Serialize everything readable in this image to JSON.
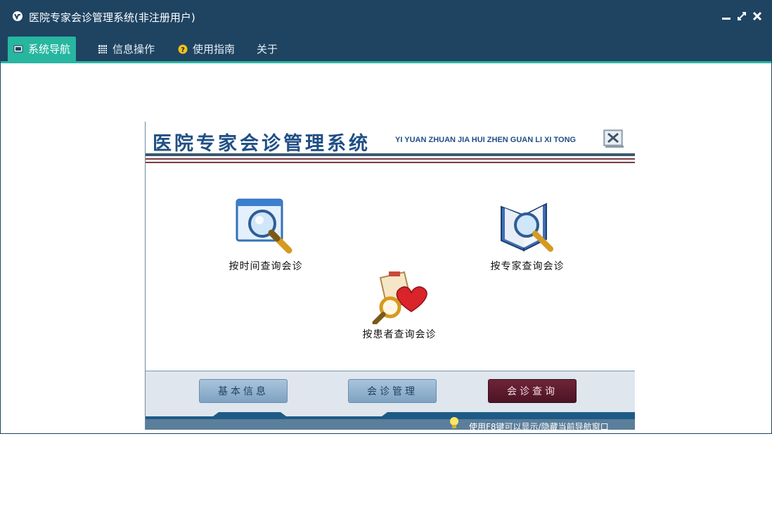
{
  "window": {
    "title": "医院专家会诊管理系统(非注册用户)"
  },
  "menu": {
    "items": [
      {
        "label": "系统导航",
        "icon": "monitor-icon"
      },
      {
        "label": "信息操作",
        "icon": "grid-icon"
      },
      {
        "label": "使用指南",
        "icon": "help-icon"
      },
      {
        "label": "关于",
        "icon": ""
      }
    ]
  },
  "nav": {
    "title": "医院专家会诊管理系统",
    "pinyin": "YI YUAN ZHUAN JIA HUI ZHEN GUAN LI XI TONG",
    "features": [
      {
        "label": "按时间查询会诊",
        "icon": "search-window-icon"
      },
      {
        "label": "按专家查询会诊",
        "icon": "search-book-icon"
      },
      {
        "label": "按患者查询会诊",
        "icon": "search-heart-icon"
      }
    ],
    "buttons": [
      {
        "label": "基本信息"
      },
      {
        "label": "会诊管理"
      },
      {
        "label": "会诊查询"
      }
    ],
    "tip": "使用F8键可以显示/隐藏当前导航窗口"
  },
  "colors": {
    "titlebar": "#1e4462",
    "accent": "#27b69f",
    "nav_title": "#1f4f85",
    "selected_button": "#5a1a2e"
  }
}
